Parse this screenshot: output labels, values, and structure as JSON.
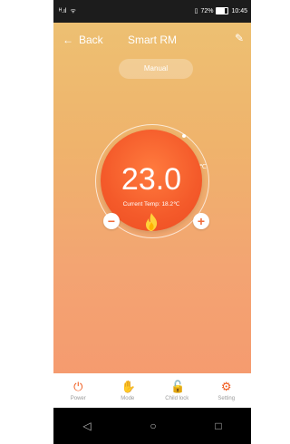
{
  "status_bar": {
    "signal": "ᴴ.ıl",
    "wifi": "ᯤ",
    "battery_text": "72%",
    "time": "10:45"
  },
  "header": {
    "back_label": "Back",
    "title": "Smart RM"
  },
  "mode": {
    "label": "Manual"
  },
  "thermostat": {
    "set_temp": "23.0",
    "unit": "℃",
    "current_temp_text": "Current Temp: 18.2℃"
  },
  "controls": {
    "minus": "−",
    "plus": "+"
  },
  "toolbar": [
    {
      "label": "Power"
    },
    {
      "label": "Mode"
    },
    {
      "label": "Child lock"
    },
    {
      "label": "Setting"
    }
  ],
  "nav": {
    "back": "◁",
    "home": "○",
    "recent": "□"
  },
  "colors": {
    "accent": "#f05a1c",
    "dial": "#f45a2a",
    "bg_top": "#edc072",
    "bg_bottom": "#f59b6f"
  }
}
